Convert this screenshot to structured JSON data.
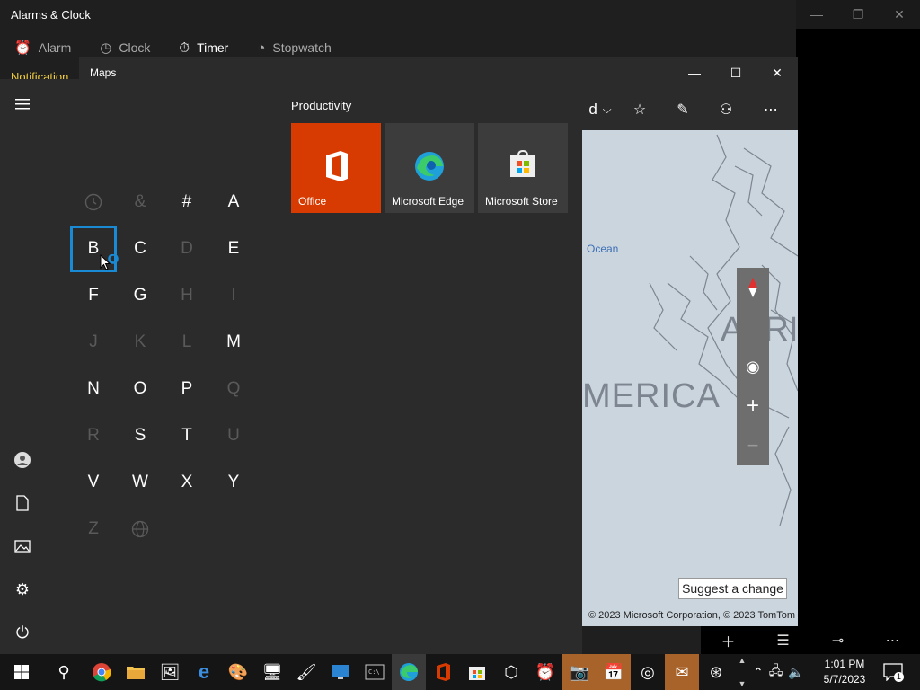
{
  "alarms": {
    "title": "Alarms & Clock",
    "tabs": [
      {
        "label": "Alarm",
        "icon": "alarm-icon"
      },
      {
        "label": "Clock",
        "icon": "world-clock-icon"
      },
      {
        "label": "Timer",
        "icon": "timer-icon"
      },
      {
        "label": "Stopwatch",
        "icon": "stopwatch-icon"
      }
    ],
    "notification": "Notification"
  },
  "maps": {
    "title": "Maps",
    "toolbar_partial_label": "d",
    "labels": {
      "ocean": "Ocean",
      "america": "MERICA",
      "africa": "AFRI"
    },
    "suggest": "Suggest a change",
    "copyright": "© 2023 Microsoft Corporation, © 2023 TomTom"
  },
  "start": {
    "letters": [
      {
        "char": "",
        "icon": "recent-clock-icon",
        "enabled": false
      },
      {
        "char": "&",
        "enabled": false
      },
      {
        "char": "#",
        "enabled": true
      },
      {
        "char": "A",
        "enabled": true
      },
      {
        "char": "B",
        "enabled": true,
        "selected": true
      },
      {
        "char": "C",
        "enabled": true
      },
      {
        "char": "D",
        "enabled": false
      },
      {
        "char": "E",
        "enabled": true
      },
      {
        "char": "F",
        "enabled": true
      },
      {
        "char": "G",
        "enabled": true
      },
      {
        "char": "H",
        "enabled": false
      },
      {
        "char": "I",
        "enabled": false
      },
      {
        "char": "J",
        "enabled": false
      },
      {
        "char": "K",
        "enabled": false
      },
      {
        "char": "L",
        "enabled": false
      },
      {
        "char": "M",
        "enabled": true
      },
      {
        "char": "N",
        "enabled": true
      },
      {
        "char": "O",
        "enabled": true
      },
      {
        "char": "P",
        "enabled": true
      },
      {
        "char": "Q",
        "enabled": false
      },
      {
        "char": "R",
        "enabled": false
      },
      {
        "char": "S",
        "enabled": true
      },
      {
        "char": "T",
        "enabled": true
      },
      {
        "char": "U",
        "enabled": false
      },
      {
        "char": "V",
        "enabled": true
      },
      {
        "char": "W",
        "enabled": true
      },
      {
        "char": "X",
        "enabled": true
      },
      {
        "char": "Y",
        "enabled": true
      },
      {
        "char": "Z",
        "enabled": false
      },
      {
        "char": "",
        "icon": "globe-icon",
        "enabled": false
      }
    ],
    "group_header": "Productivity",
    "tiles": [
      {
        "label": "Office",
        "color": "#d83b01"
      },
      {
        "label": "Microsoft Edge",
        "color": "#3c3c3c"
      },
      {
        "label": "Microsoft Store",
        "color": "#3c3c3c"
      }
    ]
  },
  "taskbar": {
    "time": "1:01 PM",
    "date": "5/7/2023",
    "notification_count": "1"
  },
  "colors": {
    "accent": "#1a8ad4",
    "office": "#d83b01",
    "taskbar_highlight": "#a8632b"
  }
}
